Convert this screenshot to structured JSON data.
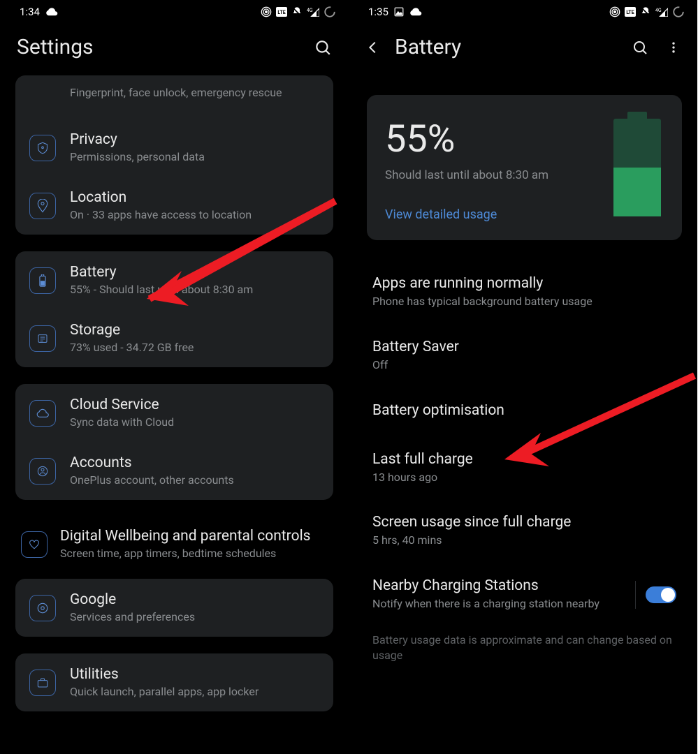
{
  "left": {
    "status": {
      "time": "1:34"
    },
    "header": {
      "title": "Settings"
    },
    "rows": {
      "fingerprint_sub": "Fingerprint, face unlock, emergency rescue",
      "privacy_title": "Privacy",
      "privacy_sub": "Permissions, personal data",
      "location_title": "Location",
      "location_sub": "On · 33 apps have access to location",
      "battery_title": "Battery",
      "battery_sub": "55% - Should last until about 8:30 am",
      "storage_title": "Storage",
      "storage_sub": "73% used - 34.72 GB free",
      "cloud_title": "Cloud Service",
      "cloud_sub": "Sync data with Cloud",
      "accounts_title": "Accounts",
      "accounts_sub": "OnePlus account, other accounts",
      "wellbeing_title": "Digital Wellbeing and parental controls",
      "wellbeing_sub": "Screen time, app timers, bedtime schedules",
      "google_title": "Google",
      "google_sub": "Services and preferences",
      "utilities_title": "Utilities",
      "utilities_sub": "Quick launch, parallel apps, app locker"
    }
  },
  "right": {
    "status": {
      "time": "1:35"
    },
    "header": {
      "title": "Battery"
    },
    "hero": {
      "pct": "55%",
      "sub": "Should last until about 8:30 am",
      "link": "View detailed usage",
      "fill_pct": 50
    },
    "items": {
      "apps_title": "Apps are running normally",
      "apps_sub": "Phone has typical background battery usage",
      "saver_title": "Battery Saver",
      "saver_sub": "Off",
      "opt_title": "Battery optimisation",
      "lastcharge_title": "Last full charge",
      "lastcharge_sub": "13 hours ago",
      "screen_title": "Screen usage since full charge",
      "screen_sub": "5 hrs, 40 mins",
      "nearby_title": "Nearby Charging Stations",
      "nearby_sub": "Notify when there is a charging station nearby",
      "footnote": "Battery usage data is approximate and can change based on usage"
    }
  }
}
